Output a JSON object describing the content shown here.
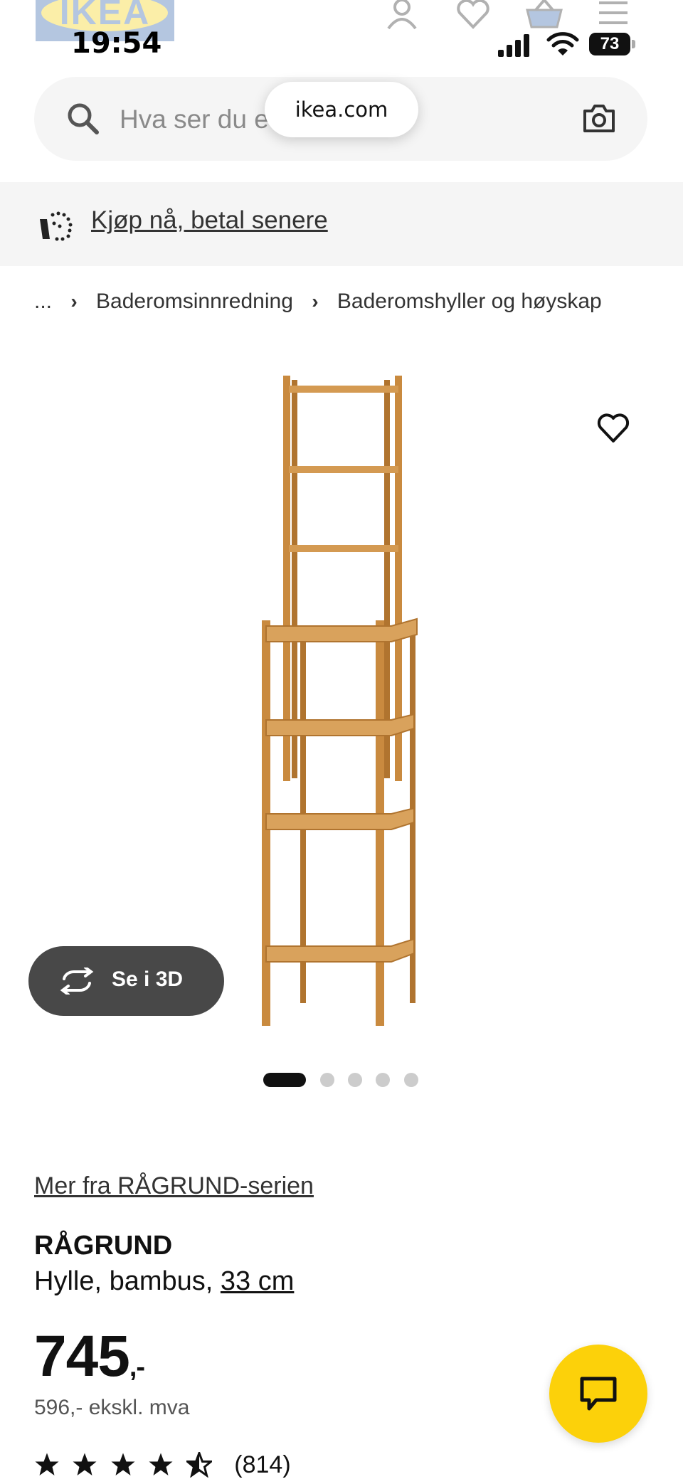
{
  "status_bar": {
    "time": "19:54",
    "battery": "73"
  },
  "header": {
    "logo_text": "IKEA"
  },
  "search": {
    "placeholder": "Hva ser du e",
    "url": "ikea.com"
  },
  "promo": {
    "text": "Kjøp nå, betal senere"
  },
  "breadcrumb": {
    "ellipsis": "...",
    "items": [
      "Baderomsinnredning",
      "Baderomshyller og høyskap"
    ]
  },
  "gallery": {
    "view_3d_label": "Se i 3D",
    "image_count": 5,
    "active_index": 0
  },
  "product": {
    "series_link": "Mer fra RÅGRUND-serien",
    "name": "RÅGRUND",
    "description": "Hylle, bambus,",
    "size_link": "33 cm",
    "price": "745",
    "price_suffix": ",-",
    "price_ex_vat": "596,- ekskl. mva",
    "rating_value": 4.5,
    "review_count": "(814)"
  },
  "colors": {
    "ikea_yellow": "#fcd10a",
    "ikea_blue": "#2b5fa8",
    "bamboo": "#c98a3f"
  }
}
